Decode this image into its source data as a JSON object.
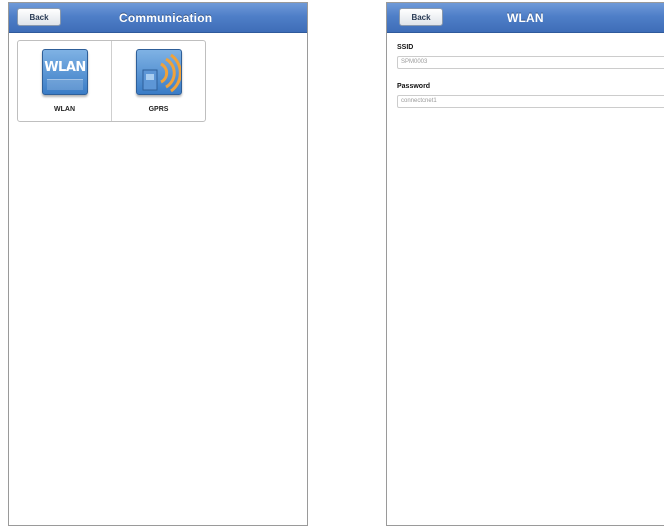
{
  "communication_screen": {
    "title": "Communication",
    "back_label": "Back",
    "tiles": [
      {
        "label": "WLAN",
        "icon": "wlan-icon",
        "icon_text": "WLAN"
      },
      {
        "label": "GPRS",
        "icon": "gprs-signal-icon"
      }
    ]
  },
  "wlan_screen": {
    "title": "WLAN",
    "back_label": "Back",
    "ssid": {
      "label": "SSID",
      "value": "SPM0003"
    },
    "password": {
      "label": "Password",
      "value": "connectcnet1"
    }
  },
  "colors": {
    "titlebar": "#4f7fc8",
    "icon_blue": "#3a7cc6",
    "signal_orange": "#f0a23a"
  }
}
